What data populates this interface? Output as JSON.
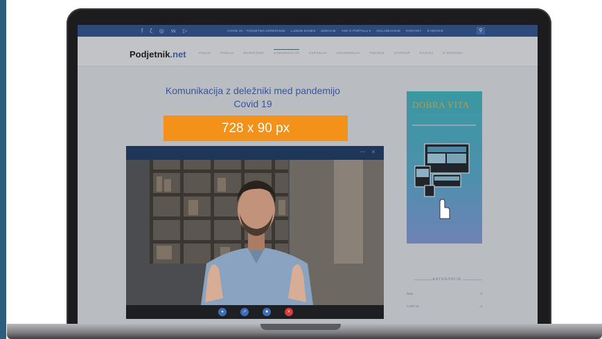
{
  "topbar": {
    "social_icons": [
      "f",
      "ζ",
      "◎",
      "𝕨",
      "▷"
    ],
    "links": [
      "COVID 19 – PODJETNO UKREPANJE",
      "LJUDJE DANES",
      "ZDRAVJE",
      "VSE O PORTALU ▾",
      "OGLAŠEVANJE",
      "KONTAKT",
      "E-NOVICE"
    ]
  },
  "site": {
    "logo_text": "Podjetnik",
    "logo_suffix": ".net",
    "nav": [
      "FOKUS",
      "POSLUJ",
      "MARKETING",
      "KOMUNIKACIJE",
      "ZAPOSLUJ",
      "ZAKONODAJA",
      "FINANCE",
      "STARTUP",
      "RAZVOJ",
      "E-DOGODKI"
    ]
  },
  "article": {
    "title": "Komunikacija z deležniki med pandemijo Covid 19",
    "ad_label": "728 x 90 px"
  },
  "sidebar": {
    "ad_brand": "DOBRA VITA",
    "categories_heading": "KATEGORIJE",
    "categories": [
      {
        "label": "Šola",
        "count": "5"
      },
      {
        "label": "Covid 19",
        "count": "4"
      }
    ]
  },
  "video_call": {
    "controls": [
      "mic",
      "screen",
      "camera",
      "end"
    ]
  },
  "colors": {
    "topbar": "#2d4a7a",
    "ad_orange": "#f39119",
    "title_blue": "#3754a6",
    "end_call": "#d93a3a"
  }
}
